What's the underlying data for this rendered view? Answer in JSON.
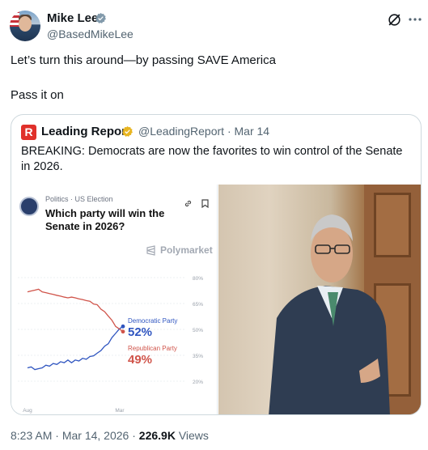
{
  "author": {
    "name": "Mike Lee",
    "handle": "@BasedMikeLee"
  },
  "tweet": {
    "line1": "Let’s turn this around—by passing SAVE America",
    "line2": "Pass it on"
  },
  "quote": {
    "logo_letter": "R",
    "name": "Leading Report",
    "handle": "@LeadingReport",
    "separator": " · ",
    "date": "Mar 14",
    "text": "BREAKING: Democrats are now the favorites to win control of the Senate in 2026."
  },
  "polymarket": {
    "category": "Politics · US Election",
    "question": "Which party will win the Senate in 2026?",
    "brand": "Polymarket",
    "democratic_label": "Democratic Party",
    "democratic_value": "52%",
    "republican_label": "Republican Party",
    "republican_value": "49%"
  },
  "chart_data": {
    "type": "line",
    "x_ticks": [
      "Aug",
      "Mar"
    ],
    "y_ticks": [
      "80%",
      "65%",
      "50%",
      "35%",
      "20%"
    ],
    "ylim": [
      20,
      80
    ],
    "grid": true,
    "series": [
      {
        "name": "Democratic Party",
        "color": "#2f55c0",
        "values": [
          28,
          28,
          27,
          27,
          28,
          29,
          29,
          30,
          30,
          31,
          31,
          32,
          31,
          32,
          32,
          33,
          33,
          34,
          35,
          36,
          38,
          40,
          42,
          45,
          48,
          50,
          52
        ]
      },
      {
        "name": "Republican Party",
        "color": "#d0544a",
        "values": [
          72,
          72,
          73,
          73,
          72,
          71,
          71,
          70,
          70,
          69,
          69,
          68,
          69,
          68,
          68,
          67,
          67,
          66,
          65,
          64,
          62,
          60,
          58,
          55,
          52,
          50,
          49
        ]
      }
    ]
  },
  "footer": {
    "time": "8:23 AM",
    "separator": " · ",
    "date": "Mar 14, 2026",
    "views_count": "226.9K",
    "views_label": " Views"
  }
}
